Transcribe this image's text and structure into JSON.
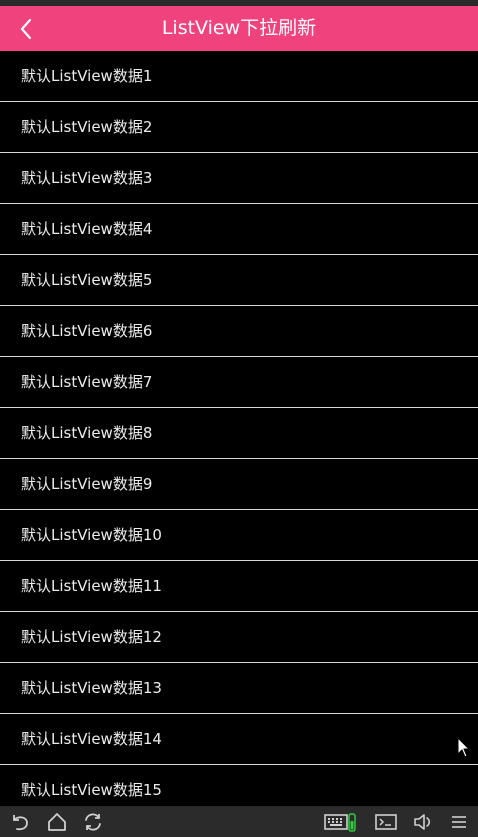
{
  "titlebar": {
    "title": "ListView下拉刷新",
    "back_icon": "chevron-left-icon",
    "background": "#f0427c"
  },
  "list": {
    "items": [
      "默认ListView数据1",
      "默认ListView数据2",
      "默认ListView数据3",
      "默认ListView数据4",
      "默认ListView数据5",
      "默认ListView数据6",
      "默认ListView数据7",
      "默认ListView数据8",
      "默认ListView数据9",
      "默认ListView数据10",
      "默认ListView数据11",
      "默认ListView数据12",
      "默认ListView数据13",
      "默认ListView数据14",
      "默认ListView数据15"
    ]
  },
  "navbar": {
    "buttons": [
      "back-icon",
      "home-icon",
      "recent-apps-icon",
      "keyboard-icon",
      "battery-icon",
      "terminal-icon",
      "volume-icon",
      "menu-icon"
    ],
    "battery_color": "#2ecc40"
  }
}
